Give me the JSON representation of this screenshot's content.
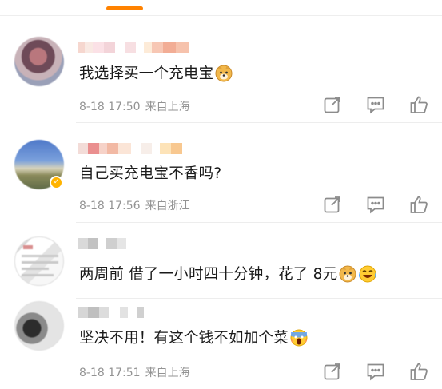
{
  "comments": [
    {
      "text": "我选择买一个充电宝",
      "time": "8-18 17:50",
      "location": "来自上海",
      "emoji": [
        "doge-emoji"
      ]
    },
    {
      "text": "自己买充电宝不香吗?",
      "time": "8-18 17:56",
      "location": "来自浙江",
      "emoji": [],
      "verified": true
    },
    {
      "text": "两周前 借了一小时四十分钟，花了 8元",
      "time": "",
      "location": "",
      "emoji": [
        "doge-emoji",
        "laugh-cry-emoji"
      ]
    },
    {
      "text": "坚决不用！有这个钱不如加个菜",
      "time": "8-18 17:51",
      "location": "来自上海",
      "emoji": [
        "scream-emoji"
      ]
    }
  ],
  "colors": {
    "accent": "#ff8200",
    "meta_gray": "#939393",
    "icon_gray": "#8c8c8c",
    "verified_badge": "#ffb300"
  },
  "icons": [
    "share-icon",
    "reply-icon",
    "like-icon"
  ]
}
